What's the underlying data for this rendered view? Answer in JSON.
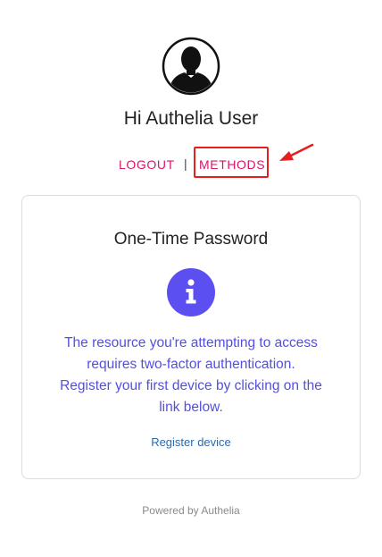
{
  "header": {
    "greeting": "Hi Authelia User",
    "avatar_icon": "user-avatar-icon"
  },
  "nav": {
    "logout_label": "LOGOUT",
    "separator": "|",
    "methods_label": "METHODS"
  },
  "card": {
    "title": "One-Time Password",
    "info_icon": "info-icon",
    "message_lines": [
      "The resource you're attempting to access",
      "requires two-factor authentication.",
      "Register your first device by clicking on the",
      "link below."
    ],
    "register_label": "Register device"
  },
  "footer": {
    "text": "Powered by Authelia"
  },
  "colors": {
    "link_pink": "#d6176b",
    "message_purple": "#5350e0",
    "info_icon_bg": "#5b4ff2",
    "register_link": "#2a6ab0",
    "annotation_red": "#e61e1e"
  }
}
